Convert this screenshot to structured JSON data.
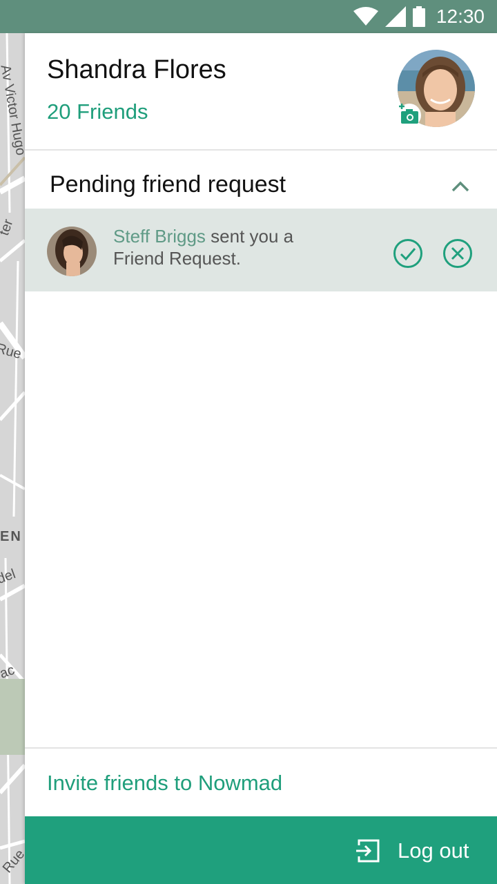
{
  "status_bar": {
    "time": "12:30",
    "icons": [
      "wifi-icon",
      "signal-icon",
      "battery-icon"
    ]
  },
  "map": {
    "labels": [
      "Av Victor Hugo",
      "ter",
      "Rue L",
      "EN",
      "del",
      "ac",
      "Rue"
    ]
  },
  "profile": {
    "name": "Shandra Flores",
    "friends_count": "20 Friends"
  },
  "pending": {
    "title": "Pending friend request",
    "request": {
      "sender": "Steff Briggs",
      "message_line1": "sent you a",
      "message_line2": "Friend Request."
    }
  },
  "invite": {
    "label": "Invite friends to Nowmad"
  },
  "logout": {
    "label": "Log out"
  },
  "colors": {
    "accent": "#1fa07d",
    "status_bar": "#5f8f7d",
    "row_bg": "#dfe6e3"
  }
}
